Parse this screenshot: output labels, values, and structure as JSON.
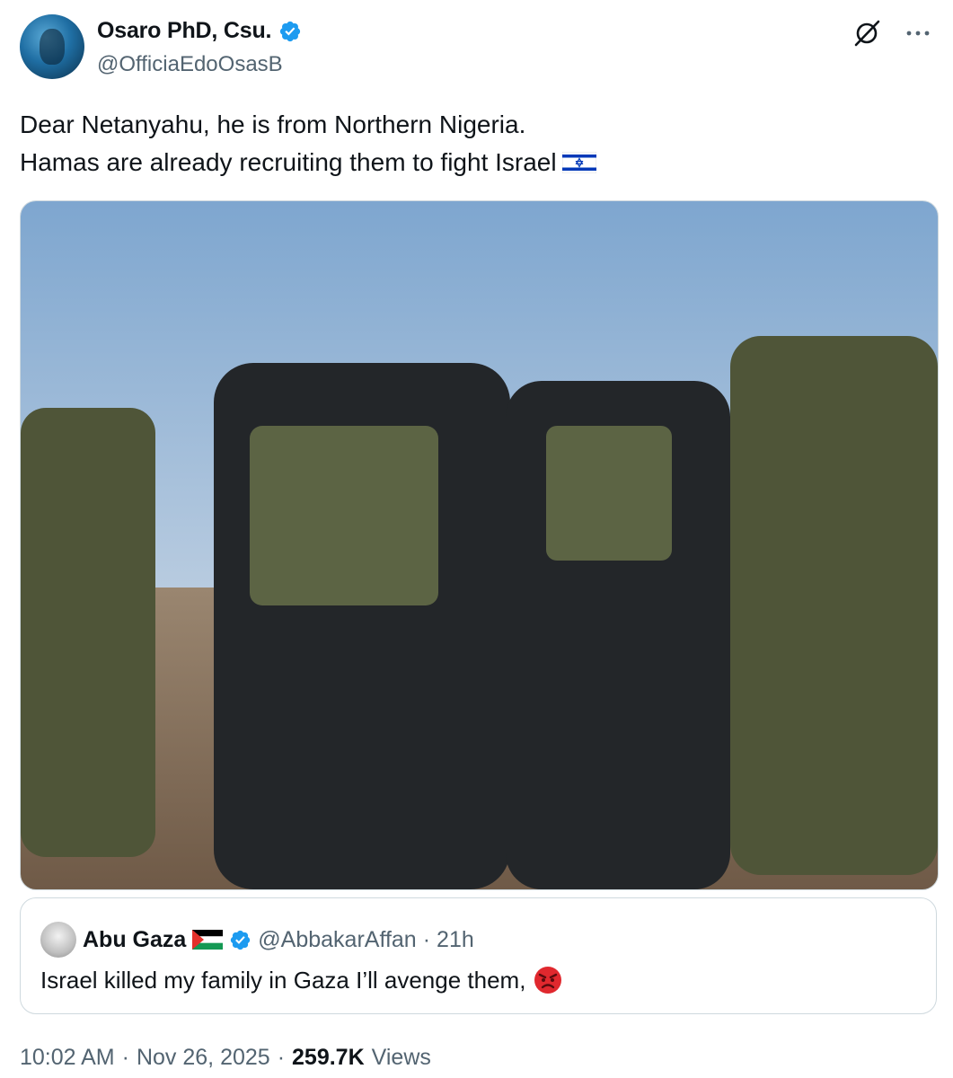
{
  "author": {
    "display_name": "Osaro PhD, Csu.",
    "handle": "@OfficiaEdoOsasB",
    "verified": true
  },
  "icons": {
    "verified": "verified-badge-icon",
    "grok": "grok-icon",
    "more": "more-icon",
    "israel_flag": "israel-flag-icon",
    "palestine_flag": "palestine-flag-icon",
    "angry": "angry-face-icon"
  },
  "tweet": {
    "line1": "Dear Netanyahu, he is from Northern Nigeria.",
    "line2": "Hamas are already recruiting them to fight Israel"
  },
  "quote": {
    "display_name": "Abu Gaza",
    "handle": "@AbbakarAffan",
    "separator": "·",
    "time": "21h",
    "text": "Israel killed my family in Gaza I’ll avenge them,"
  },
  "meta": {
    "time": "10:02 AM",
    "separator1": "·",
    "date": "Nov 26, 2025",
    "separator2": "·",
    "views_count": "259.7K",
    "views_label": "Views"
  },
  "colors": {
    "text": "#0f1419",
    "secondary": "#536471",
    "verified_blue": "#1d9bf0",
    "border": "#cfd9de"
  }
}
